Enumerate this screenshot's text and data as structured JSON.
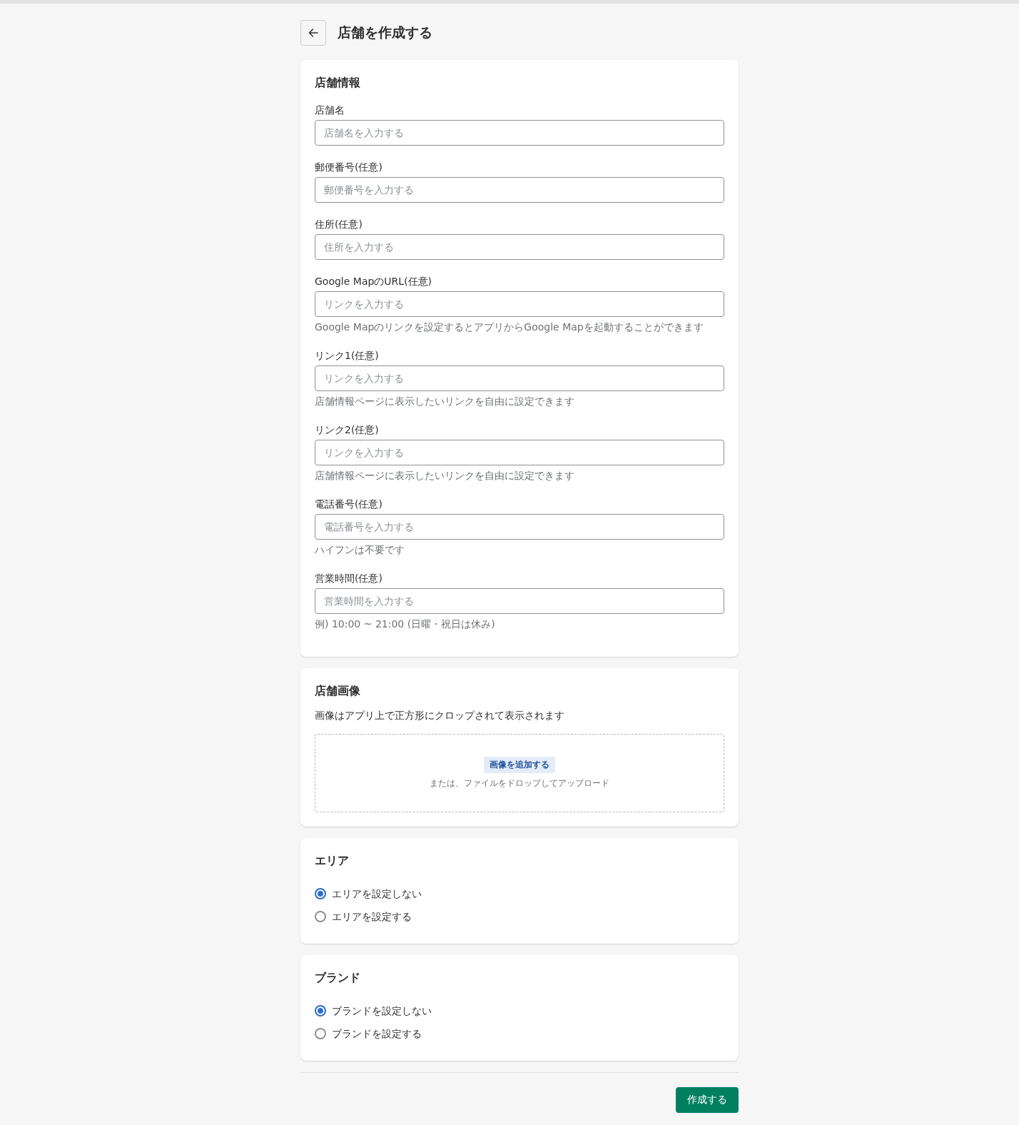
{
  "header": {
    "title": "店舗を作成する"
  },
  "info_card": {
    "title": "店舗情報",
    "fields": [
      {
        "label": "店舗名",
        "placeholder": "店舗名を入力する"
      },
      {
        "label": "郵便番号(任意)",
        "placeholder": "郵便番号を入力する"
      },
      {
        "label": "住所(任意)",
        "placeholder": "住所を入力する"
      },
      {
        "label": "Google MapのURL(任意)",
        "placeholder": "リンクを入力する",
        "help": "Google Mapのリンクを設定するとアプリからGoogle Mapを起動することができます"
      },
      {
        "label": "リンク1(任意)",
        "placeholder": "リンクを入力する",
        "help": "店舗情報ページに表示したいリンクを自由に設定できます"
      },
      {
        "label": "リンク2(任意)",
        "placeholder": "リンクを入力する",
        "help": "店舗情報ページに表示したいリンクを自由に設定できます"
      },
      {
        "label": "電話番号(任意)",
        "placeholder": "電話番号を入力する",
        "help": "ハイフンは不要です"
      },
      {
        "label": "営業時間(任意)",
        "placeholder": "営業時間を入力する",
        "help": "例) 10:00 ~ 21:00 (日曜・祝日は休み)"
      }
    ]
  },
  "image_card": {
    "title": "店舗画像",
    "description": "画像はアプリ上で正方形にクロップされて表示されます",
    "dropzone": {
      "button": "画像を追加する",
      "hint": "または、ファイルをドロップしてアップロード"
    }
  },
  "radio_cards": [
    {
      "title": "エリア",
      "options": [
        {
          "label": "エリアを設定しない",
          "selected": true
        },
        {
          "label": "エリアを設定する",
          "selected": false
        }
      ]
    },
    {
      "title": "ブランド",
      "options": [
        {
          "label": "ブランドを設定しない",
          "selected": true
        },
        {
          "label": "ブランドを設定する",
          "selected": false
        }
      ]
    }
  ],
  "submit_button": "作成する"
}
